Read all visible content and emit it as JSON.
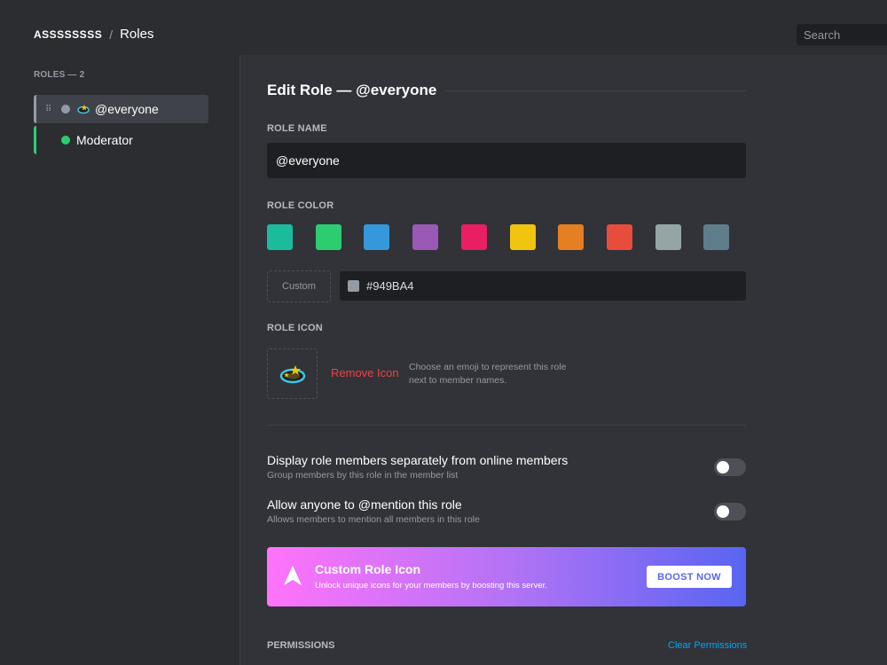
{
  "header": {
    "server_name": "ASSSSSSSS",
    "separator": "/",
    "page": "Roles",
    "search_placeholder": "Search"
  },
  "sidebar": {
    "roles_count": "ROLES — 2",
    "roles": [
      {
        "label": "@everyone",
        "color": "#949ba4",
        "emoji": "orbit-star-icon"
      },
      {
        "label": "Moderator",
        "color": "#2ecc71"
      }
    ]
  },
  "editor": {
    "title": "Edit Role — @everyone",
    "role_name_label": "ROLE NAME",
    "role_name_value": "@everyone",
    "role_color_label": "ROLE COLOR",
    "swatches": [
      "#1abc9c",
      "#2ecc71",
      "#3498db",
      "#9b59b6",
      "#e91e63",
      "#f1c40f",
      "#e67e22",
      "#e74c3c",
      "#95a5a6",
      "#607d8b"
    ],
    "custom_label": "Custom",
    "custom_hex": "#949BA4",
    "role_icon_label": "ROLE ICON",
    "remove_icon": "Remove Icon",
    "icon_help": "Choose an emoji to represent this role next to member names.",
    "settings": [
      {
        "title": "Display role members separately from online members",
        "desc": "Group members by this role in the member list",
        "enabled": false
      },
      {
        "title": "Allow anyone to @mention this role",
        "desc": "Allows members to mention all members in this role",
        "enabled": false
      }
    ],
    "boost": {
      "title": "Custom Role Icon",
      "desc": "Unlock unique icons for your members by boosting this server.",
      "button": "BOOST NOW"
    },
    "permissions_label": "PERMISSIONS",
    "clear_permissions": "Clear Permissions"
  }
}
